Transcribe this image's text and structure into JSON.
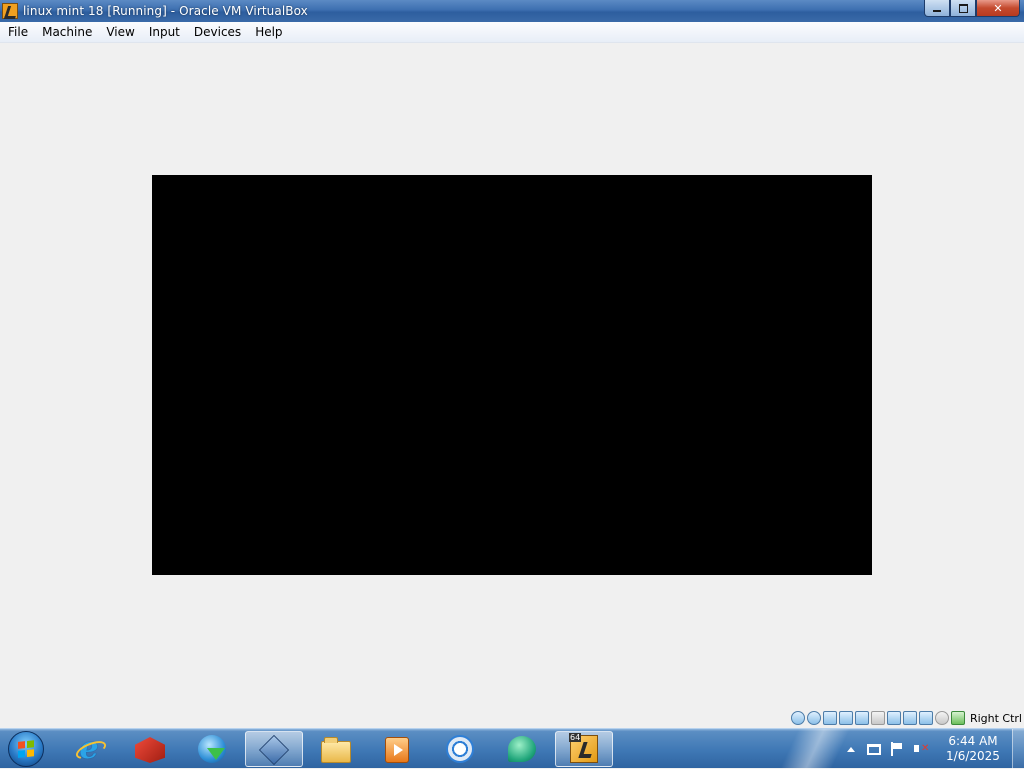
{
  "window": {
    "title": "linux mint 18 [Running] - Oracle VM VirtualBox",
    "controls": {
      "minimize": "minimize",
      "restore": "restore",
      "close": "close"
    }
  },
  "menu": {
    "items": [
      "File",
      "Machine",
      "View",
      "Input",
      "Devices",
      "Help"
    ]
  },
  "vm_display": {
    "background_color": "#000000"
  },
  "status_bar": {
    "icons": [
      "hard-disk-icon",
      "optical-drive-icon",
      "audio-icon",
      "network-icon",
      "usb-icon",
      "shared-folders-icon",
      "display-icon",
      "video-capture-icon",
      "virtualization-icon",
      "mouse-integration-icon",
      "keyboard-icon"
    ],
    "host_key_label": "Right Ctrl"
  },
  "taskbar": {
    "apps": [
      {
        "icon": "internet-explorer-icon",
        "active": false
      },
      {
        "icon": "red-box-app-icon",
        "active": false
      },
      {
        "icon": "internet-download-manager-icon",
        "active": false
      },
      {
        "icon": "virtualbox-manager-icon",
        "active": true
      },
      {
        "icon": "file-explorer-icon",
        "active": false
      },
      {
        "icon": "media-player-icon",
        "active": false
      },
      {
        "icon": "chrome-browser-icon",
        "active": false
      },
      {
        "icon": "chat-bubble-app-icon",
        "active": false
      },
      {
        "icon": "virtualbox-vm-icon",
        "active": true,
        "badge": "64"
      }
    ],
    "clock": {
      "time": "6:44 AM",
      "date": "1/6/2025"
    }
  },
  "colors": {
    "titlebar": "#3d6fb0",
    "menubar": "#f0f4fa",
    "window_background": "#f0f0f0",
    "taskbar": "#3f78b5",
    "close_button": "#c44a2e"
  }
}
